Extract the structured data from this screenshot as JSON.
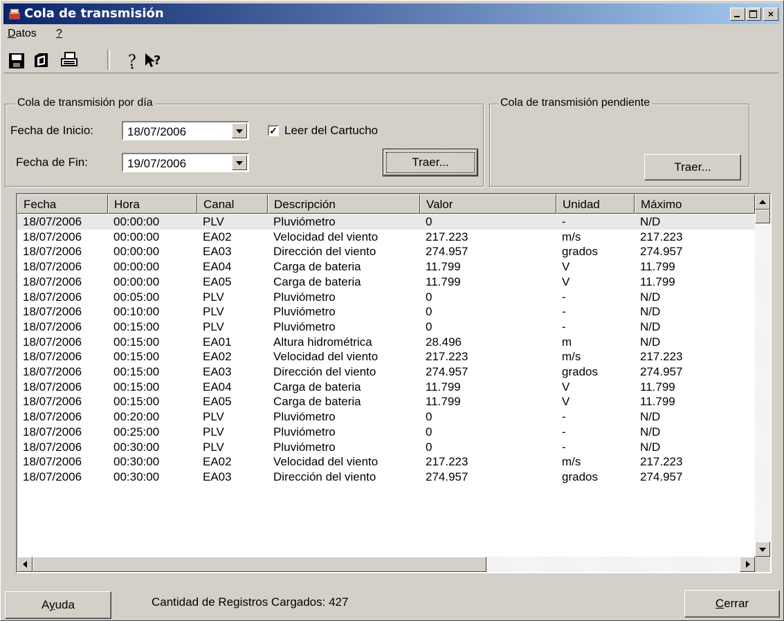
{
  "window": {
    "title": "Cola de transmisión"
  },
  "menu": [
    {
      "label_pre": "",
      "label_u": "D",
      "label_post": "atos"
    },
    {
      "label_pre": "",
      "label_u": "?",
      "label_post": ""
    }
  ],
  "toolbar": [
    "save-icon",
    "open-icon",
    "print-icon",
    "help-icon",
    "context-help-icon"
  ],
  "by_day": {
    "legend": "Cola de transmisión por día",
    "start_label": "Fecha de Inicio:",
    "start_value": "18/07/2006",
    "end_label": "Fecha de Fin:",
    "end_value": "19/07/2006",
    "checkbox_label": "Leer del Cartucho",
    "checkbox_checked": true,
    "fetch_label": "Traer..."
  },
  "pending": {
    "legend": "Cola de transmisión pendiente",
    "fetch_label": "Traer..."
  },
  "table": {
    "columns": [
      "Fecha",
      "Hora",
      "Canal",
      "Descripción",
      "Valor",
      "Unidad",
      "Máximo"
    ],
    "rows": [
      [
        "18/07/2006",
        "00:00:00",
        "PLV",
        "Pluviómetro",
        "0",
        "-",
        "N/D"
      ],
      [
        "18/07/2006",
        "00:00:00",
        "EA02",
        "Velocidad del viento",
        "217.223",
        "m/s",
        "217.223"
      ],
      [
        "18/07/2006",
        "00:00:00",
        "EA03",
        "Dirección del viento",
        "274.957",
        "grados",
        "274.957"
      ],
      [
        "18/07/2006",
        "00:00:00",
        "EA04",
        "Carga de bateria",
        "11.799",
        "V",
        "11.799"
      ],
      [
        "18/07/2006",
        "00:00:00",
        "EA05",
        "Carga de bateria",
        "11.799",
        "V",
        "11.799"
      ],
      [
        "18/07/2006",
        "00:05:00",
        "PLV",
        "Pluviómetro",
        "0",
        "-",
        "N/D"
      ],
      [
        "18/07/2006",
        "00:10:00",
        "PLV",
        "Pluviómetro",
        "0",
        "-",
        "N/D"
      ],
      [
        "18/07/2006",
        "00:15:00",
        "PLV",
        "Pluviómetro",
        "0",
        "-",
        "N/D"
      ],
      [
        "18/07/2006",
        "00:15:00",
        "EA01",
        "Altura hidrométrica",
        "28.496",
        "m",
        "N/D"
      ],
      [
        "18/07/2006",
        "00:15:00",
        "EA02",
        "Velocidad del viento",
        "217.223",
        "m/s",
        "217.223"
      ],
      [
        "18/07/2006",
        "00:15:00",
        "EA03",
        "Dirección del viento",
        "274.957",
        "grados",
        "274.957"
      ],
      [
        "18/07/2006",
        "00:15:00",
        "EA04",
        "Carga de bateria",
        "11.799",
        "V",
        "11.799"
      ],
      [
        "18/07/2006",
        "00:15:00",
        "EA05",
        "Carga de bateria",
        "11.799",
        "V",
        "11.799"
      ],
      [
        "18/07/2006",
        "00:20:00",
        "PLV",
        "Pluviómetro",
        "0",
        "-",
        "N/D"
      ],
      [
        "18/07/2006",
        "00:25:00",
        "PLV",
        "Pluviómetro",
        "0",
        "-",
        "N/D"
      ],
      [
        "18/07/2006",
        "00:30:00",
        "PLV",
        "Pluviómetro",
        "0",
        "-",
        "N/D"
      ],
      [
        "18/07/2006",
        "00:30:00",
        "EA02",
        "Velocidad del viento",
        "217.223",
        "m/s",
        "217.223"
      ],
      [
        "18/07/2006",
        "00:30:00",
        "EA03",
        "Dirección del viento",
        "274.957",
        "grados",
        "274.957"
      ]
    ]
  },
  "footer": {
    "help_pre": "A",
    "help_u": "y",
    "help_post": "uda",
    "status": "Cantidad de Registros Cargados: 427",
    "close_pre": "",
    "close_u": "C",
    "close_post": "errar"
  }
}
